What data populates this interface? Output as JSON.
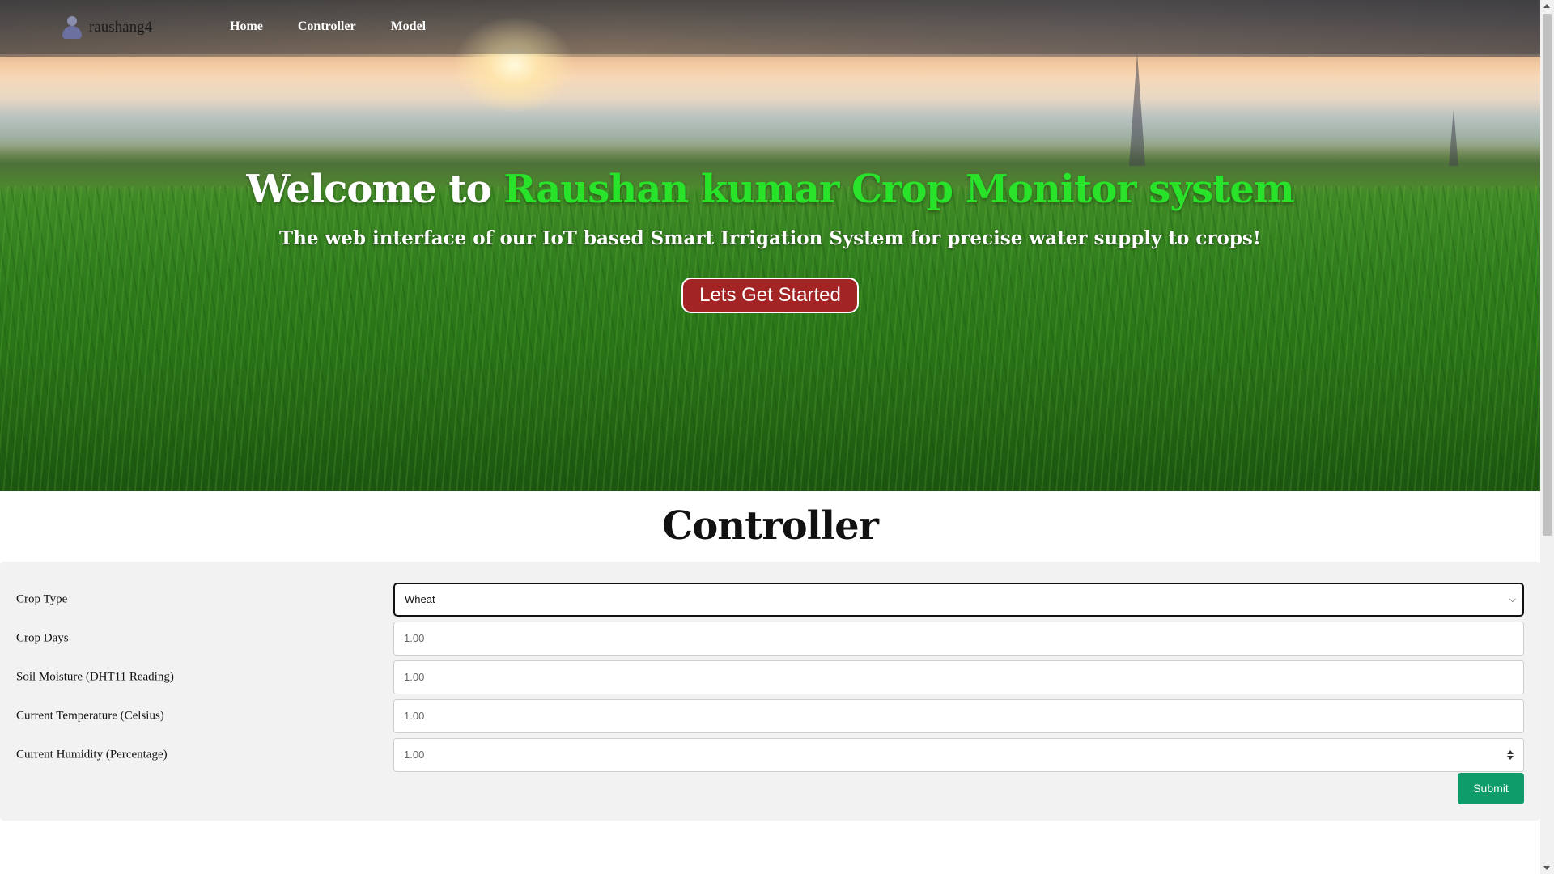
{
  "nav": {
    "brand": "raushang4",
    "links": [
      "Home",
      "Controller",
      "Model"
    ]
  },
  "hero": {
    "title_prefix": "Welcome to ",
    "title_accent": "Raushan kumar Crop Monitor system",
    "subtitle": "The web interface of our IoT based Smart Irrigation System for precise water supply to crops!",
    "cta_label": "Lets Get Started"
  },
  "controller": {
    "title": "Controller",
    "fields": [
      {
        "label": "Crop Type",
        "value": "Wheat",
        "type": "select"
      },
      {
        "label": "Crop Days",
        "value": "1.00",
        "type": "number"
      },
      {
        "label": "Soil Moisture (DHT11 Reading)",
        "value": "1.00",
        "type": "number"
      },
      {
        "label": "Current Temperature (Celsius)",
        "value": "1.00",
        "type": "number"
      },
      {
        "label": "Current Humidity (Percentage)",
        "value": "1.00",
        "type": "number"
      }
    ],
    "submit_label": "Submit"
  },
  "colors": {
    "title_accent": "#29e22a",
    "cta_background": "#a32424",
    "submit_background": "#0e9d6a",
    "form_panel_background": "#f2f2f2"
  },
  "icons": {
    "brand": "user-logo-icon",
    "select_arrow": "chevron-down-icon",
    "number_spinner": "spinner-icon"
  }
}
